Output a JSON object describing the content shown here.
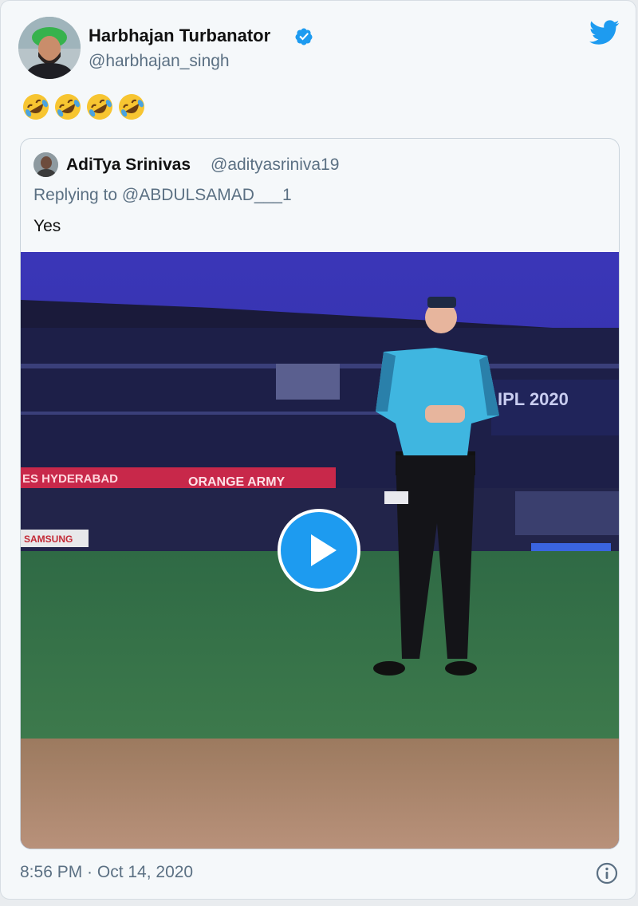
{
  "tweet": {
    "author_name": "Harbhajan Turbanator",
    "author_handle": "@harbhajan_singh",
    "text": "🤣🤣🤣🤣",
    "timestamp": "8:56 PM · Oct 14, 2020"
  },
  "quoted": {
    "author_name": "AdiTya Srinivas",
    "author_handle": "@adityasriniva19",
    "reply_to": "Replying to @ABDULSAMAD___1",
    "text": "Yes",
    "video": {
      "banner_left": "ES HYDERABAD",
      "banner_right": "ORANGE ARMY",
      "scoreboard": "IPL 2020",
      "sign_text": "SAMSUNG"
    }
  },
  "colors": {
    "accent": "#1d9bf0",
    "secondary_text": "#5b7083"
  },
  "icons": [
    "verified-icon",
    "twitter-bird-icon",
    "play-icon",
    "info-icon",
    "rofl-emoji"
  ]
}
